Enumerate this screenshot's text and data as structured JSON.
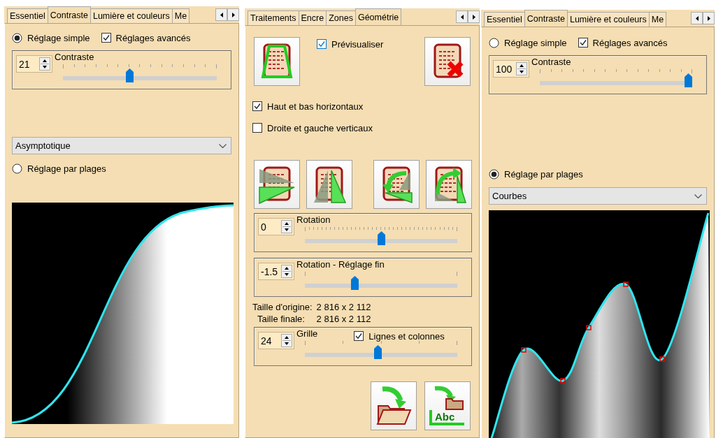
{
  "left_panel": {
    "kind": "contrast",
    "tabs": [
      {
        "label": "Essentiel",
        "selected": false
      },
      {
        "label": "Contraste",
        "selected": true
      },
      {
        "label": "Lumière et couleurs",
        "selected": false
      },
      {
        "label": "Me",
        "selected": false
      }
    ],
    "simple_mode": {
      "label": "Réglage simple",
      "selected": true
    },
    "advanced": {
      "label": "Réglages avancés",
      "checked": true
    },
    "contrast": {
      "value": "21",
      "label": "Contraste",
      "level": 0.43
    },
    "controls": [
      {
        "kind": "dropdown",
        "value": "Asymptotique"
      },
      {
        "kind": "radio",
        "label": "Réglage par plages",
        "selected": false
      }
    ],
    "curve": {
      "kind": "sigmoid"
    }
  },
  "center_panel": {
    "kind": "geometry",
    "tabs": [
      {
        "label": "Traitements",
        "selected": false
      },
      {
        "label": "Encre",
        "selected": false
      },
      {
        "label": "Zones",
        "selected": false
      },
      {
        "label": "Géométrie",
        "selected": true
      }
    ],
    "top_buttons": [
      {
        "kind": "trapezoid"
      },
      {
        "kind": "delete"
      }
    ],
    "preview": {
      "label": "Prévisualiser",
      "checked": true
    },
    "checkboxes": [
      {
        "label": "Haut et bas horizontaux",
        "checked": true
      },
      {
        "label": "Droite et gauche verticaux",
        "checked": false
      }
    ],
    "transform_buttons": [
      {
        "kind": "flip_vertical"
      },
      {
        "kind": "flip_horizontal"
      },
      {
        "kind": "rotate_left"
      },
      {
        "kind": "rotate_right"
      }
    ],
    "sliders": [
      {
        "value": "0",
        "label": "Rotation",
        "level": 0.5
      },
      {
        "value": "-1.5",
        "label": "Rotation - Réglage fin",
        "level": 0.32
      }
    ],
    "sizes": [
      {
        "label": "Taille d'origine:",
        "value": "2 816 x 2 112"
      },
      {
        "label": "Taille finale:",
        "value": "2 816 x 2 112"
      }
    ],
    "grid": {
      "value": "24",
      "label": "Grille",
      "level": 0.48,
      "lines": {
        "label": "Lignes et colonnes",
        "checked": true
      }
    },
    "export_buttons": [
      {
        "kind": "folder"
      },
      {
        "kind": "folder_text",
        "icon_text": "Abc"
      }
    ]
  },
  "right_panel": {
    "kind": "contrast",
    "tabs": [
      {
        "label": "Essentiel",
        "selected": false
      },
      {
        "label": "Contraste",
        "selected": true
      },
      {
        "label": "Lumière et couleurs",
        "selected": false
      },
      {
        "label": "Me",
        "selected": false
      }
    ],
    "simple_mode": {
      "label": "Réglage simple",
      "selected": false
    },
    "advanced": {
      "label": "Réglages avancés",
      "checked": true
    },
    "contrast": {
      "value": "100",
      "label": "Contraste",
      "level": 1.0
    },
    "controls": [
      {
        "kind": "radio",
        "label": "Réglage par plages",
        "selected": true
      },
      {
        "kind": "dropdown",
        "value": "Courbes"
      }
    ],
    "curve": {
      "kind": "handles"
    }
  }
}
